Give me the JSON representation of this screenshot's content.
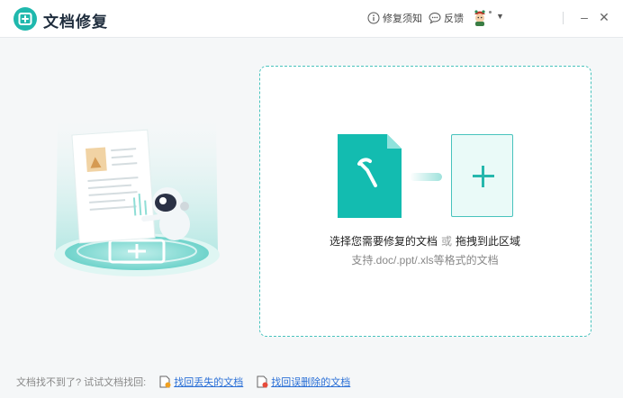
{
  "app": {
    "title": "文档修复"
  },
  "toolbar": {
    "repair_notes_label": "修复须知",
    "feedback_label": "反馈"
  },
  "dropzone": {
    "main_text": "选择您需要修复的文档",
    "or_text": "或",
    "drag_text": "拖拽到此区域",
    "support_text": "支持.doc/.ppt/.xls等格式的文档"
  },
  "footer": {
    "hint": "文档找不到了? 试试文档找回:",
    "find_lost_label": "找回丢失的文档",
    "find_deleted_label": "找回误删除的文档"
  },
  "colors": {
    "accent": "#26b7ad",
    "link": "#2a6fd6",
    "background": "#f5f7f8"
  }
}
